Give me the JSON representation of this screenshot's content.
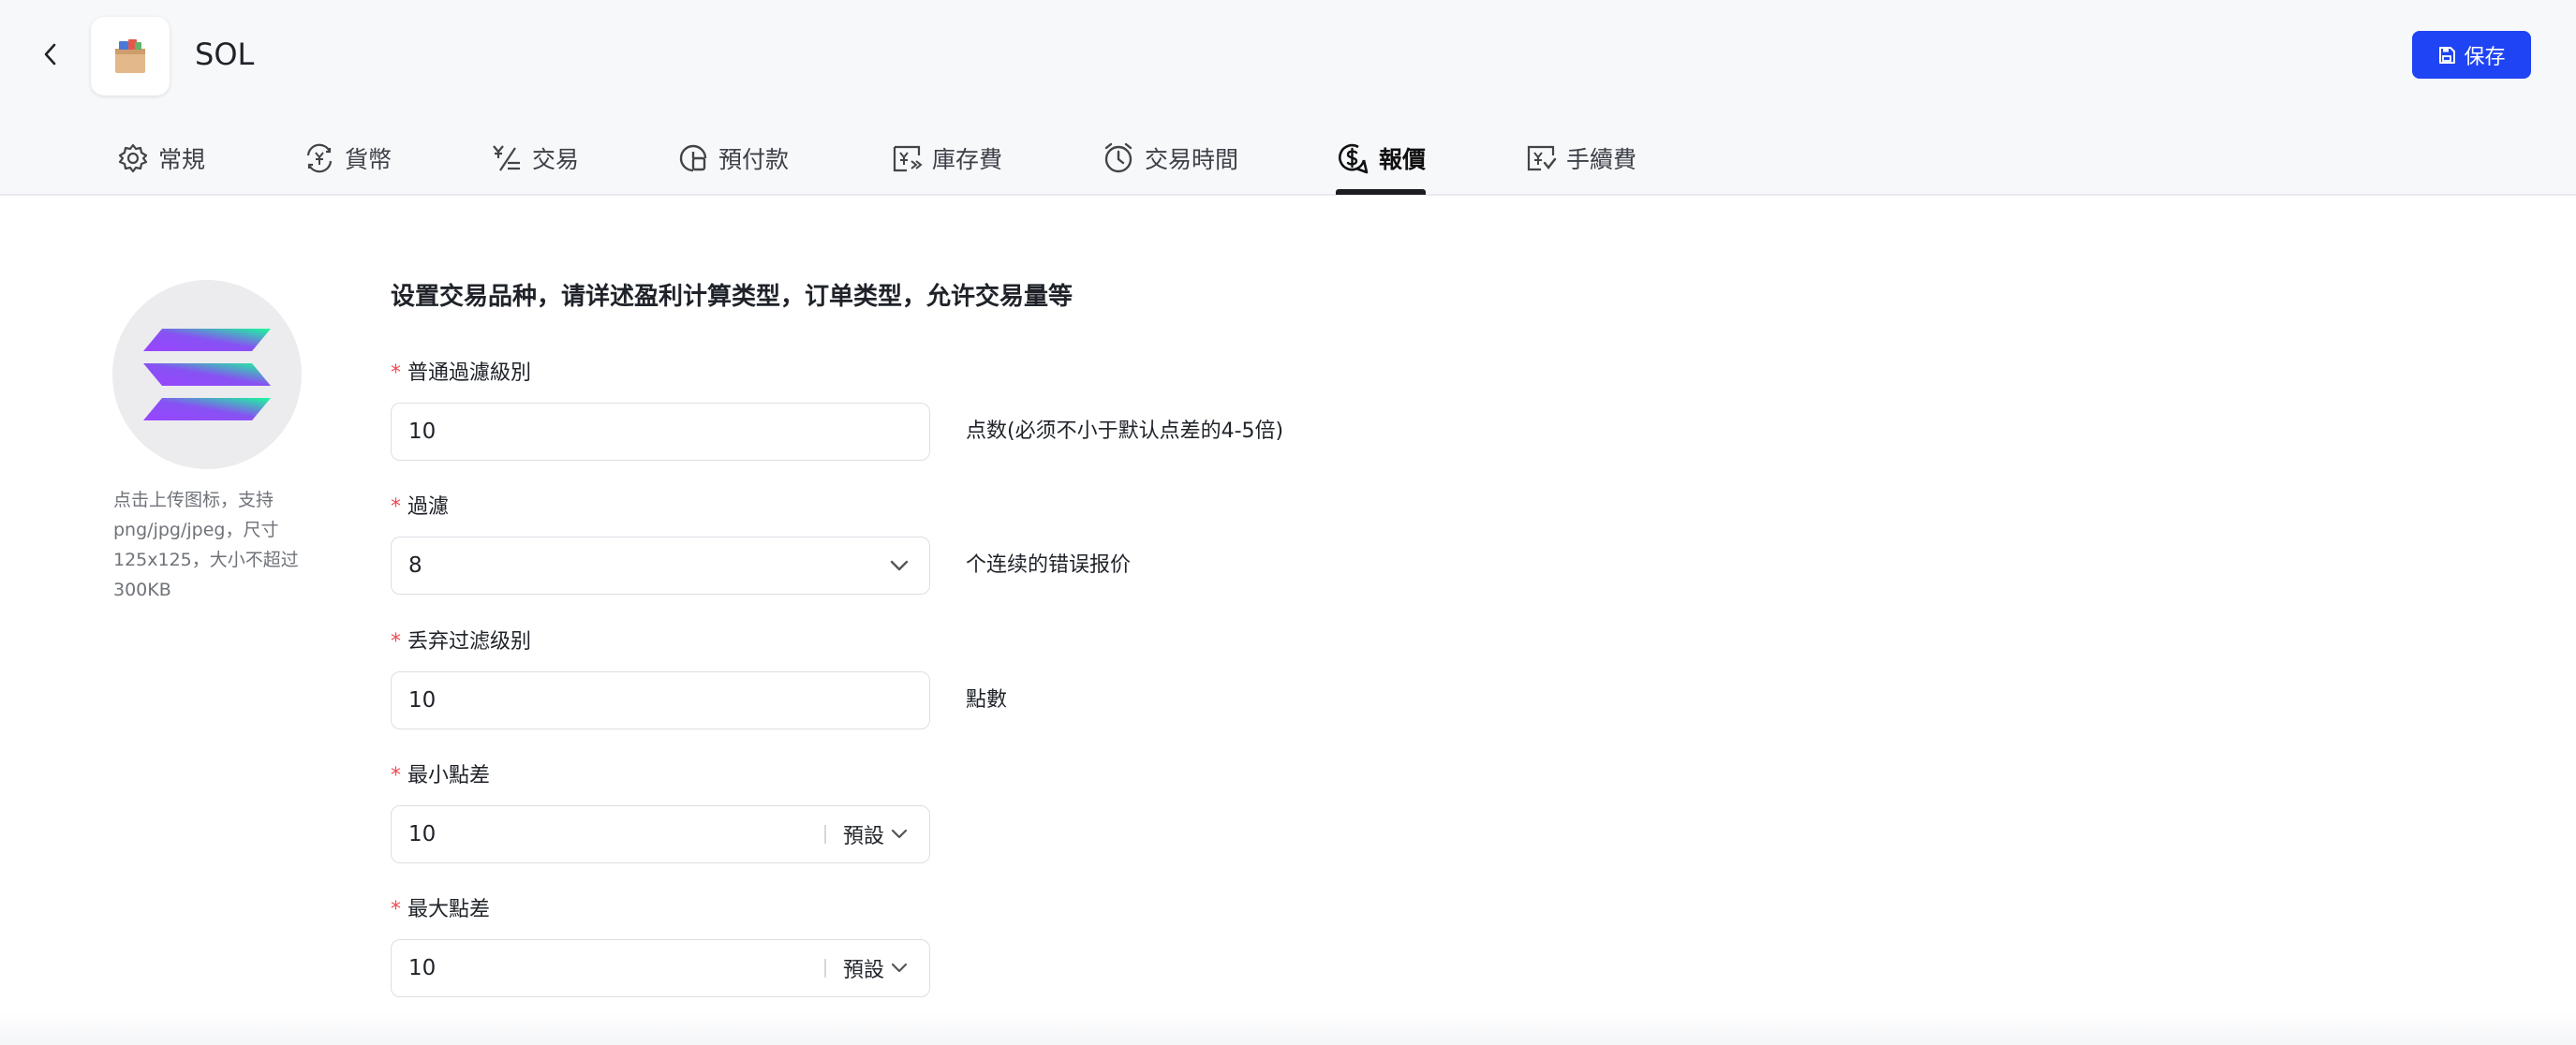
{
  "header": {
    "title": "SOL",
    "save_label": "保存"
  },
  "tabs": [
    {
      "label": "常規",
      "icon": "gear-icon"
    },
    {
      "label": "貨幣",
      "icon": "currency-exchange-icon"
    },
    {
      "label": "交易",
      "icon": "yen-trade-icon"
    },
    {
      "label": "預付款",
      "icon": "prepay-icon"
    },
    {
      "label": "庫存費",
      "icon": "storage-fee-icon"
    },
    {
      "label": "交易時間",
      "icon": "clock-icon"
    },
    {
      "label": "報價",
      "icon": "quote-dollar-icon",
      "active": true
    },
    {
      "label": "手續費",
      "icon": "commission-icon"
    }
  ],
  "sidebar": {
    "upload_hint": "点击上传图标，支持png/jpg/jpeg，尺寸125x125，大小不超过300KB"
  },
  "form": {
    "intro": "设置交易品种，请详述盈利计算类型，订单类型，允许交易量等",
    "required_mark": "*",
    "fields": [
      {
        "label": "普通過濾級別",
        "value": "10",
        "hint": "点数(必须不小于默认点差的4-5倍)"
      },
      {
        "label": "過濾",
        "value": "8",
        "hint": "个连续的错误报价"
      },
      {
        "label": "丢弃过滤级别",
        "value": "10",
        "hint": "點數"
      },
      {
        "label": "最小點差",
        "value": "10",
        "suffix": "預設"
      },
      {
        "label": "最大點差",
        "value": "10",
        "suffix": "預設"
      }
    ]
  },
  "colors": {
    "accent": "#1f44f4",
    "required": "#f5484f",
    "header_bg": "#f7f8fa",
    "active_tab_indicator": "#1b1d22"
  }
}
